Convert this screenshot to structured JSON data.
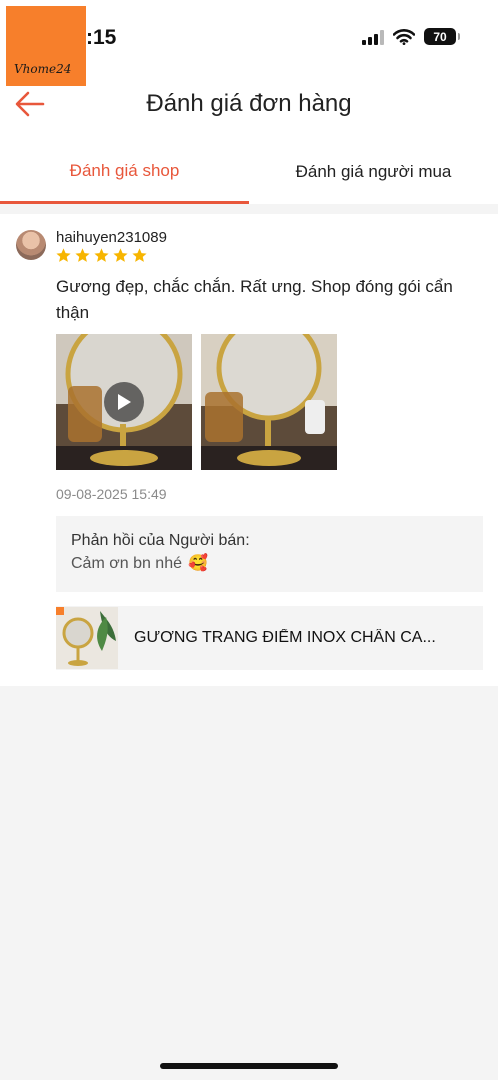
{
  "status_bar": {
    "time": ":15",
    "battery": "70"
  },
  "watermark": {
    "text": "Vhome24"
  },
  "header": {
    "title": "Đánh giá đơn hàng"
  },
  "tabs": [
    {
      "label": "Đánh giá shop",
      "active": true
    },
    {
      "label": "Đánh giá người mua",
      "active": false
    }
  ],
  "review": {
    "username": "haihuyen231089",
    "rating": 5,
    "comment": "Gương đẹp, chắc chắn. Rất ưng. Shop đóng gói cẩn thận",
    "media": [
      {
        "type": "video"
      },
      {
        "type": "image"
      }
    ],
    "datetime": "09-08-2025 15:49",
    "seller_reply": {
      "title": "Phản hồi của Người bán:",
      "text": "Cảm ơn bn nhé",
      "emoji": "🥰"
    },
    "product": {
      "name": "GƯƠNG TRANG ĐIỂM INOX CHÂN CA..."
    }
  },
  "colors": {
    "accent": "#e8573b",
    "star": "#f7b500",
    "logo_bg": "#f77f2b"
  }
}
